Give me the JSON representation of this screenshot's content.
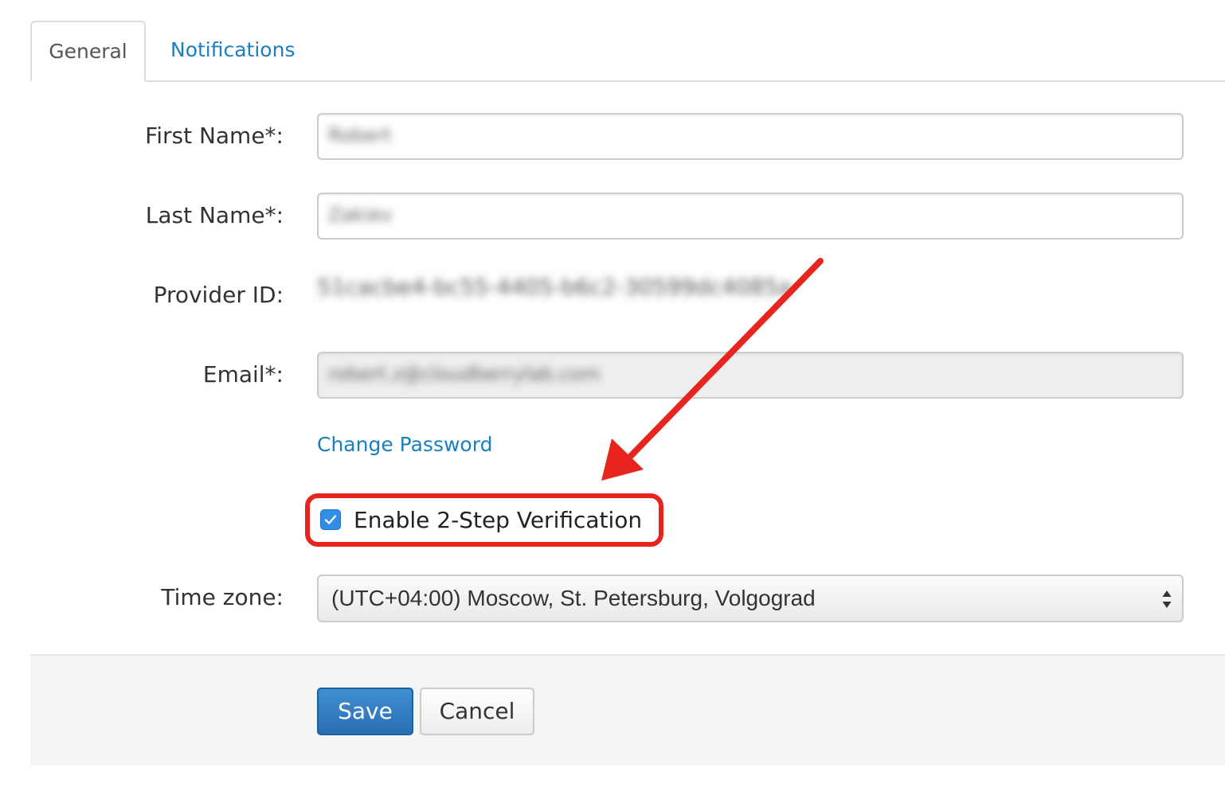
{
  "tabs": [
    {
      "label": "General",
      "active": true
    },
    {
      "label": "Notifications",
      "active": false
    }
  ],
  "form": {
    "first_name": {
      "label": "First Name*:",
      "value": "Robert"
    },
    "last_name": {
      "label": "Last Name*:",
      "value": "Zakiev"
    },
    "provider_id": {
      "label": "Provider ID:",
      "value": "51cacbe4-bc55-4405-b6c2-30599dc4085a"
    },
    "email": {
      "label": "Email*:",
      "value": "robert.z@cloudberrylab.com",
      "disabled": true
    },
    "change_password": "Change Password",
    "two_step": {
      "label": "Enable 2-Step Verification",
      "checked": true
    },
    "time_zone": {
      "label": "Time zone:",
      "value": "(UTC+04:00) Moscow, St. Petersburg, Volgograd"
    }
  },
  "buttons": {
    "save": "Save",
    "cancel": "Cancel"
  },
  "colors": {
    "link": "#1a7fc1",
    "primary": "#2a6eb3",
    "annotation": "#e7251e",
    "checkbox": "#2f8ee6"
  },
  "icons": {
    "checkbox": "check-icon",
    "select": "updown-arrows-icon",
    "annotation": "red-arrow-icon"
  }
}
